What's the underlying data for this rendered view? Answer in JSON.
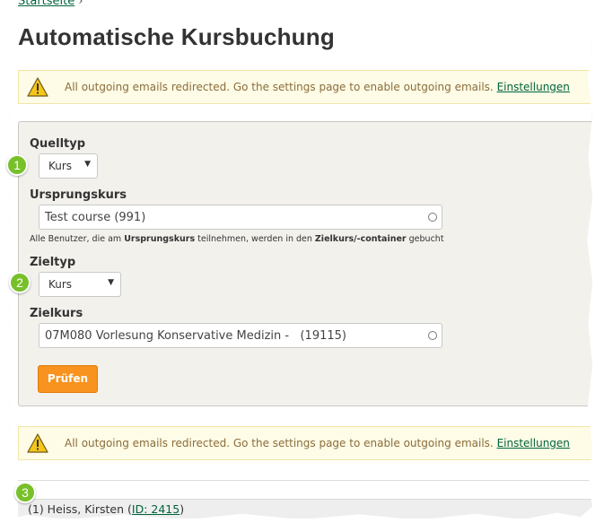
{
  "breadcrumb": {
    "home_label": "Startseite",
    "separator": "›"
  },
  "page_title": "Automatische Kursbuchung",
  "alert": {
    "message": "All outgoing emails redirected. Go the settings page to enable outgoing emails.",
    "link_label": "Einstellungen"
  },
  "form": {
    "source_type": {
      "label": "Quelltyp",
      "value": "Kurs"
    },
    "source_course": {
      "label": "Ursprungskurs",
      "value": "Test course (991)"
    },
    "help": {
      "part1": "Alle Benutzer, die am ",
      "bold1": "Ursprungskurs",
      "part2": " teilnehmen, werden in den ",
      "bold2": "Zielkurs/-container",
      "part3": " gebucht"
    },
    "target_type": {
      "label": "Zieltyp",
      "value": "Kurs"
    },
    "target_course": {
      "label": "Zielkurs",
      "value": "07M080 Vorlesung Konservative Medizin -   (19115)"
    },
    "check_button": "Prüfen"
  },
  "result": {
    "prefix": "(1) Heiss, Kirsten (",
    "id_link": "ID: 2415",
    "suffix": ")"
  },
  "markers": [
    "1",
    "2",
    "3"
  ],
  "colors": {
    "accent_green": "#78c02a",
    "link_green": "#00643c",
    "button_orange": "#f7931e",
    "alert_bg": "#fefbe6"
  }
}
